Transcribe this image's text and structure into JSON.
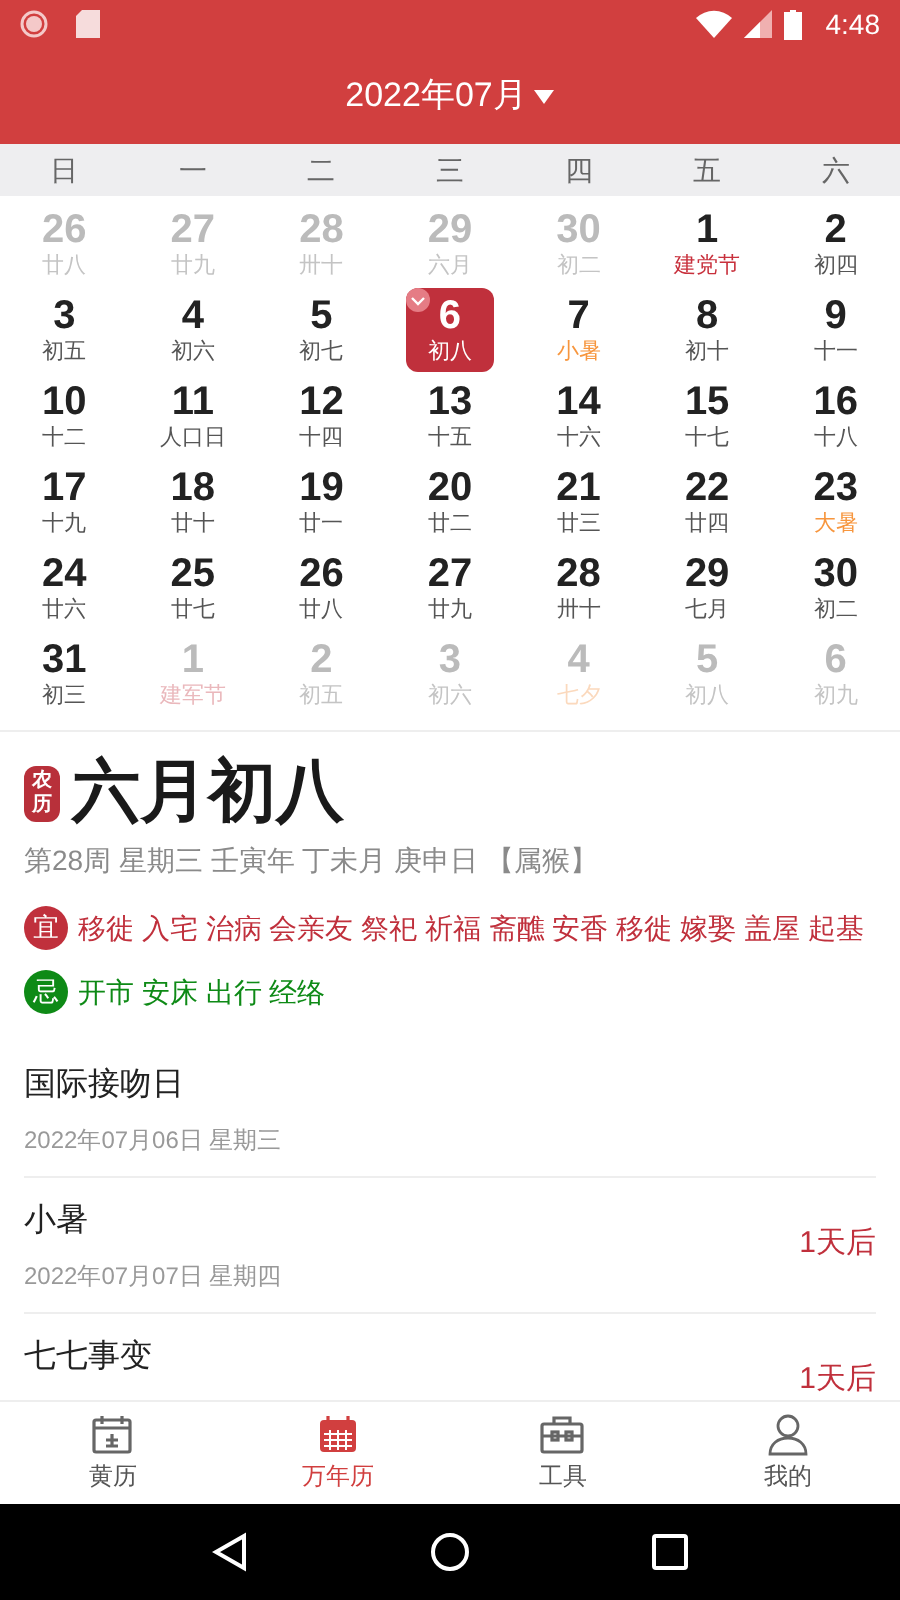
{
  "status_bar": {
    "time": "4:48"
  },
  "header": {
    "title": "2022年07月"
  },
  "weekdays": [
    "日",
    "一",
    "二",
    "三",
    "四",
    "五",
    "六"
  ],
  "calendar": [
    [
      {
        "day": "26",
        "sub": "廿八",
        "kind": "lunar",
        "other_month": true,
        "selected": false
      },
      {
        "day": "27",
        "sub": "廿九",
        "kind": "lunar",
        "other_month": true,
        "selected": false
      },
      {
        "day": "28",
        "sub": "卅十",
        "kind": "lunar",
        "other_month": true,
        "selected": false
      },
      {
        "day": "29",
        "sub": "六月",
        "kind": "lunar",
        "other_month": true,
        "selected": false
      },
      {
        "day": "30",
        "sub": "初二",
        "kind": "lunar",
        "other_month": true,
        "selected": false
      },
      {
        "day": "1",
        "sub": "建党节",
        "kind": "festival",
        "other_month": false,
        "selected": false
      },
      {
        "day": "2",
        "sub": "初四",
        "kind": "lunar",
        "other_month": false,
        "selected": false
      }
    ],
    [
      {
        "day": "3",
        "sub": "初五",
        "kind": "lunar",
        "other_month": false,
        "selected": false
      },
      {
        "day": "4",
        "sub": "初六",
        "kind": "lunar",
        "other_month": false,
        "selected": false
      },
      {
        "day": "5",
        "sub": "初七",
        "kind": "lunar",
        "other_month": false,
        "selected": false
      },
      {
        "day": "6",
        "sub": "初八",
        "kind": "lunar",
        "other_month": false,
        "selected": true
      },
      {
        "day": "7",
        "sub": "小暑",
        "kind": "term",
        "other_month": false,
        "selected": false
      },
      {
        "day": "8",
        "sub": "初十",
        "kind": "lunar",
        "other_month": false,
        "selected": false
      },
      {
        "day": "9",
        "sub": "十一",
        "kind": "lunar",
        "other_month": false,
        "selected": false
      }
    ],
    [
      {
        "day": "10",
        "sub": "十二",
        "kind": "lunar",
        "other_month": false,
        "selected": false
      },
      {
        "day": "11",
        "sub": "人口日",
        "kind": "lunar",
        "other_month": false,
        "selected": false
      },
      {
        "day": "12",
        "sub": "十四",
        "kind": "lunar",
        "other_month": false,
        "selected": false
      },
      {
        "day": "13",
        "sub": "十五",
        "kind": "lunar",
        "other_month": false,
        "selected": false
      },
      {
        "day": "14",
        "sub": "十六",
        "kind": "lunar",
        "other_month": false,
        "selected": false
      },
      {
        "day": "15",
        "sub": "十七",
        "kind": "lunar",
        "other_month": false,
        "selected": false
      },
      {
        "day": "16",
        "sub": "十八",
        "kind": "lunar",
        "other_month": false,
        "selected": false
      }
    ],
    [
      {
        "day": "17",
        "sub": "十九",
        "kind": "lunar",
        "other_month": false,
        "selected": false
      },
      {
        "day": "18",
        "sub": "廿十",
        "kind": "lunar",
        "other_month": false,
        "selected": false
      },
      {
        "day": "19",
        "sub": "廿一",
        "kind": "lunar",
        "other_month": false,
        "selected": false
      },
      {
        "day": "20",
        "sub": "廿二",
        "kind": "lunar",
        "other_month": false,
        "selected": false
      },
      {
        "day": "21",
        "sub": "廿三",
        "kind": "lunar",
        "other_month": false,
        "selected": false
      },
      {
        "day": "22",
        "sub": "廿四",
        "kind": "lunar",
        "other_month": false,
        "selected": false
      },
      {
        "day": "23",
        "sub": "大暑",
        "kind": "term",
        "other_month": false,
        "selected": false
      }
    ],
    [
      {
        "day": "24",
        "sub": "廿六",
        "kind": "lunar",
        "other_month": false,
        "selected": false
      },
      {
        "day": "25",
        "sub": "廿七",
        "kind": "lunar",
        "other_month": false,
        "selected": false
      },
      {
        "day": "26",
        "sub": "廿八",
        "kind": "lunar",
        "other_month": false,
        "selected": false
      },
      {
        "day": "27",
        "sub": "廿九",
        "kind": "lunar",
        "other_month": false,
        "selected": false
      },
      {
        "day": "28",
        "sub": "卅十",
        "kind": "lunar",
        "other_month": false,
        "selected": false
      },
      {
        "day": "29",
        "sub": "七月",
        "kind": "lunar",
        "other_month": false,
        "selected": false
      },
      {
        "day": "30",
        "sub": "初二",
        "kind": "lunar",
        "other_month": false,
        "selected": false
      }
    ],
    [
      {
        "day": "31",
        "sub": "初三",
        "kind": "lunar",
        "other_month": false,
        "selected": false
      },
      {
        "day": "1",
        "sub": "建军节",
        "kind": "festival",
        "other_month": true,
        "selected": false
      },
      {
        "day": "2",
        "sub": "初五",
        "kind": "lunar",
        "other_month": true,
        "selected": false
      },
      {
        "day": "3",
        "sub": "初六",
        "kind": "lunar",
        "other_month": true,
        "selected": false
      },
      {
        "day": "4",
        "sub": "七夕",
        "kind": "term",
        "other_month": true,
        "selected": false
      },
      {
        "day": "5",
        "sub": "初八",
        "kind": "lunar",
        "other_month": true,
        "selected": false
      },
      {
        "day": "6",
        "sub": "初九",
        "kind": "lunar",
        "other_month": true,
        "selected": false
      }
    ]
  ],
  "lunar": {
    "badge": "农历",
    "date": "六月初八",
    "details": "第28周 星期三 壬寅年 丁未月 庚申日 【属猴】",
    "good": {
      "label": "宜",
      "items": "移徙 入宅 治病 会亲友 祭祀 祈福 斋醮 安香 移徙 嫁娶 盖屋 起基"
    },
    "bad": {
      "label": "忌",
      "items": "开市 安床 出行 经络"
    }
  },
  "events": [
    {
      "title": "国际接吻日",
      "date": "2022年07月06日 星期三"
    },
    {
      "title": "小暑",
      "date": "2022年07月07日 星期四",
      "countdown": "1天后"
    },
    {
      "title": "七七事变",
      "countdown": "1天后"
    }
  ],
  "bottom_nav": [
    {
      "label": "黄历",
      "kind": "almanac",
      "selected": false
    },
    {
      "label": "万年历",
      "kind": "calendar",
      "selected": true
    },
    {
      "label": "工具",
      "kind": "toolbox",
      "selected": false
    },
    {
      "label": "我的",
      "kind": "person",
      "selected": false
    }
  ]
}
